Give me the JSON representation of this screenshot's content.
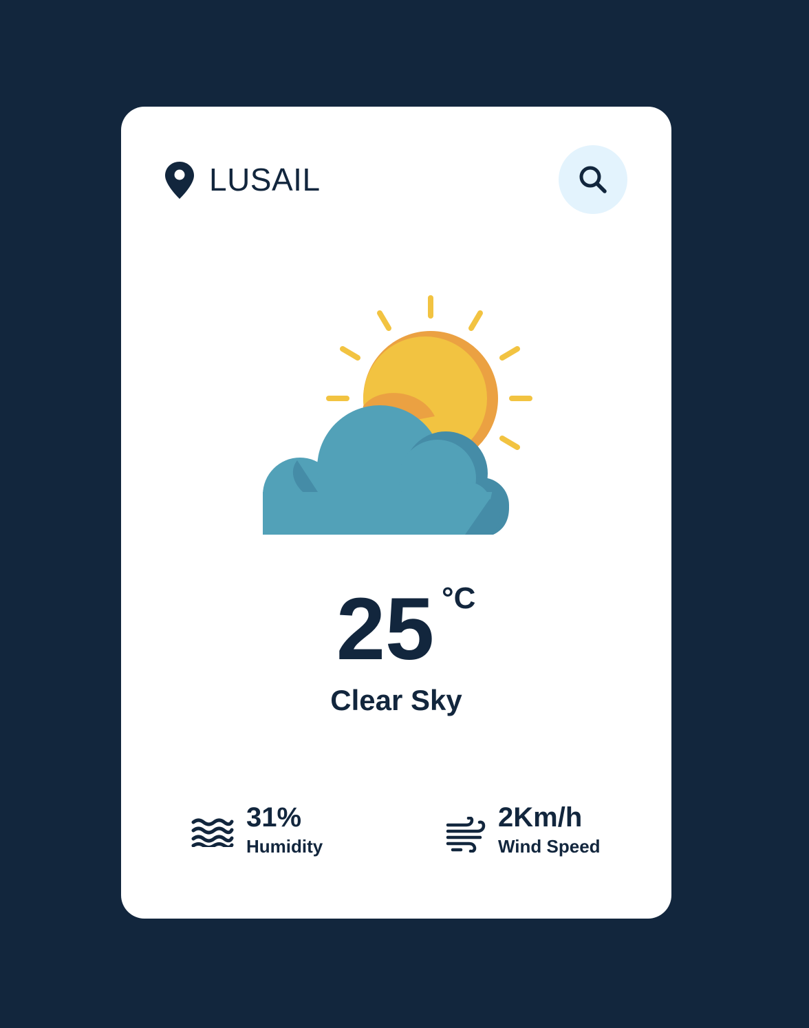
{
  "location": {
    "icon": "map-pin-icon",
    "city": "LUSAIL"
  },
  "search": {
    "icon": "search-icon",
    "button_color": "#e3f3fd"
  },
  "weather": {
    "icon": "sun-behind-cloud-icon",
    "temperature": "25",
    "unit": "°C",
    "description": "Clear Sky"
  },
  "stats": {
    "humidity": {
      "icon": "water-waves-icon",
      "value": "31%",
      "label": "Humidity"
    },
    "wind": {
      "icon": "wind-icon",
      "value": "2Km/h",
      "label": "Wind Speed"
    }
  },
  "colors": {
    "background": "#12263d",
    "card": "#ffffff",
    "text": "#12263d",
    "sun": "#f2c341",
    "sun_shade": "#eba142",
    "cloud": "#52a1b8",
    "cloud_shade": "#458ca7"
  }
}
